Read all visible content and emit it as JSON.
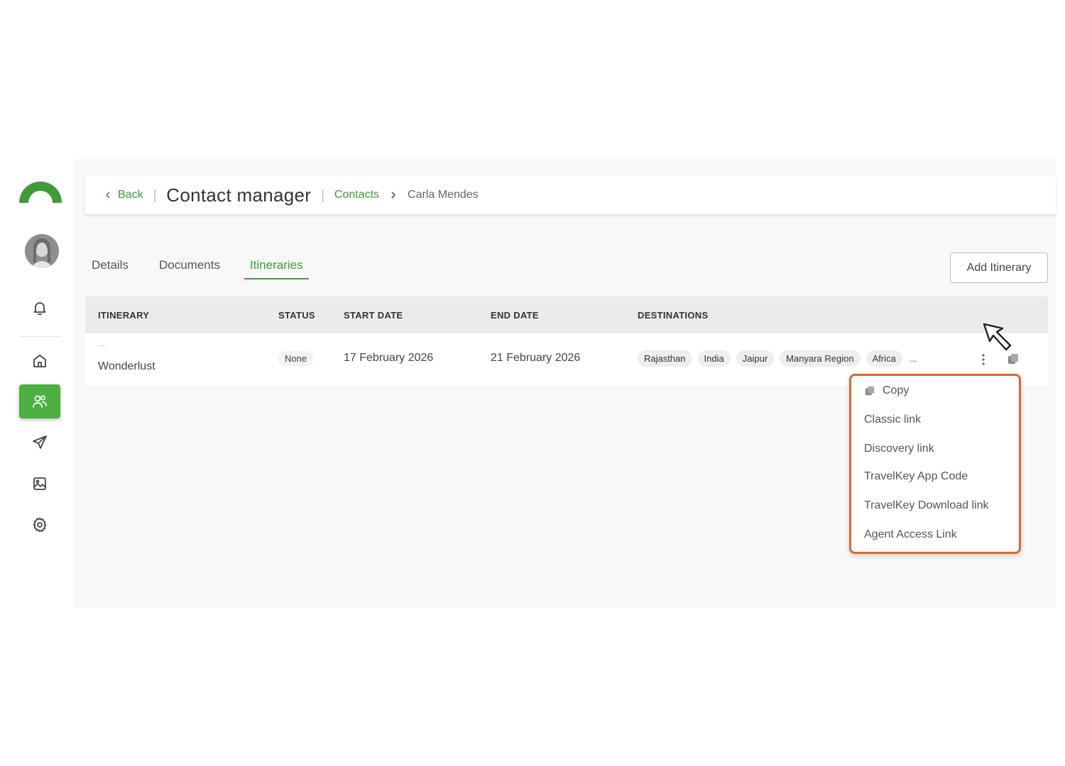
{
  "header": {
    "back_label": "Back",
    "title": "Contact manager",
    "breadcrumb_link": "Contacts",
    "breadcrumb_current": "Carla Mendes"
  },
  "tabs": [
    {
      "label": "Details",
      "active": false
    },
    {
      "label": "Documents",
      "active": false
    },
    {
      "label": "Itineraries",
      "active": true
    }
  ],
  "add_button_label": "Add Itinerary",
  "table": {
    "headers": [
      "ITINERARY",
      "STATUS",
      "START DATE",
      "END DATE",
      "DESTINATIONS"
    ],
    "rows": [
      {
        "itinerary_prefix": "—",
        "itinerary": "Wonderlust",
        "status": "None",
        "start_date": "17 February 2026",
        "end_date": "21 February 2026",
        "destinations": [
          "Rajasthan",
          "India",
          "Jaipur",
          "Manyara Region",
          "Africa"
        ],
        "more": "..."
      }
    ]
  },
  "copy_menu": {
    "items": [
      "Copy",
      "Classic link",
      "Discovery link",
      "TravelKey App Code",
      "TravelKey Download link",
      "Agent Access Link"
    ]
  },
  "colors": {
    "brand_green": "#3d9c35",
    "active_sidebar": "#4caf3f",
    "highlight_orange": "#e0662b"
  },
  "sidebar_icons": [
    "bell-icon",
    "home-icon",
    "contacts-icon",
    "send-icon",
    "image-icon",
    "settings-icon"
  ]
}
